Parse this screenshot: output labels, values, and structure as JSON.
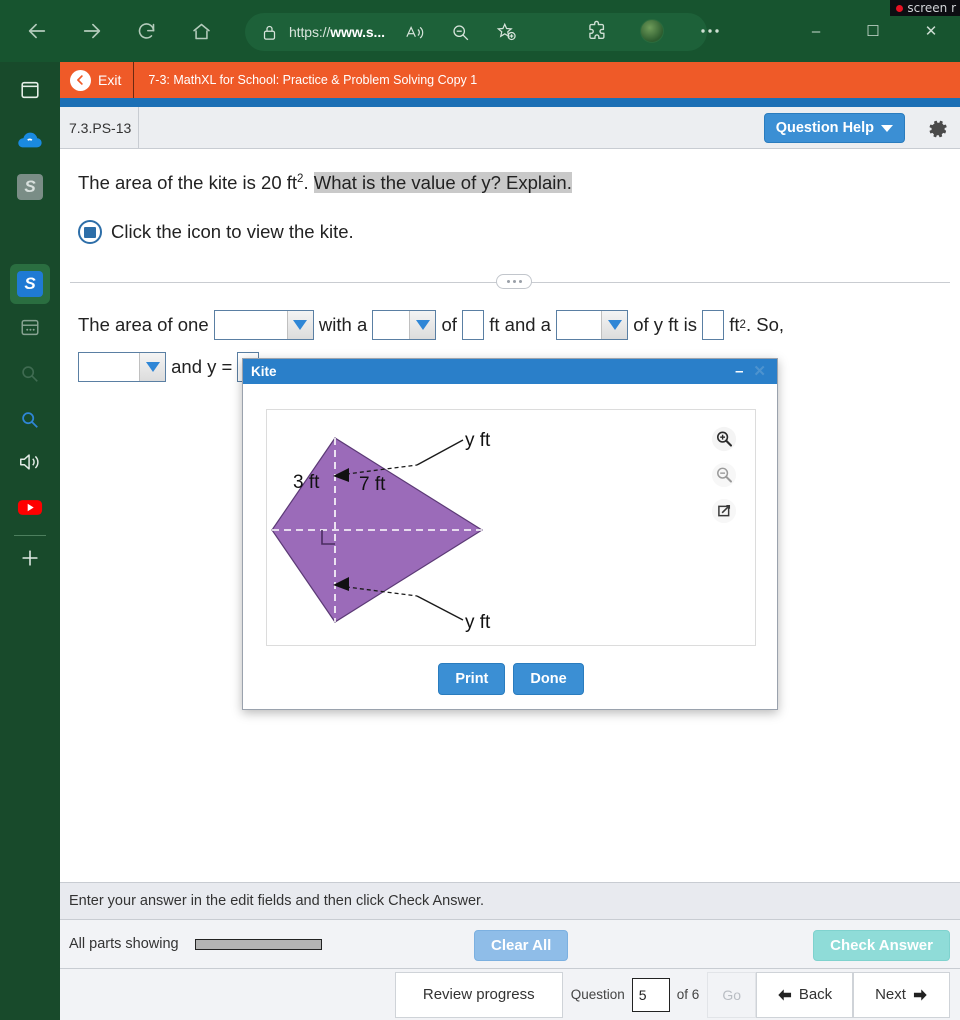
{
  "browser": {
    "nav": {
      "back": "back-arrow",
      "forward": "forward-arrow",
      "reload": "reload",
      "home": "home"
    },
    "url_prefix": "https://",
    "url_bold": "www.s...",
    "lock_icon": "lock-icon",
    "read_aloud_icon": "read-aloud-icon",
    "zoom_icon": "zoom-out-icon",
    "favorite_icon": "add-favorite-icon",
    "extensions_icon": "extensions-icon",
    "profile_icon": "profile-avatar",
    "more_icon": "more-settings-icon",
    "minimize": "–",
    "maximize": "☐",
    "close": "✕",
    "recording_label": "screen r"
  },
  "rail": {
    "items": [
      {
        "name": "tab-actions",
        "label": "Tab actions"
      },
      {
        "name": "edge-copilot",
        "label": "Copilot"
      },
      {
        "name": "app-s-inactive",
        "label": "S"
      },
      {
        "name": "app-s-active",
        "label": "S"
      },
      {
        "name": "collections",
        "label": "Collections"
      },
      {
        "name": "search-dim",
        "label": "Search"
      },
      {
        "name": "search-blue",
        "label": "Search"
      },
      {
        "name": "sound",
        "label": "Sound"
      },
      {
        "name": "youtube",
        "label": "YouTube"
      },
      {
        "name": "add",
        "label": "+"
      }
    ]
  },
  "mathxl": {
    "exit_label": "Exit",
    "assignment_title": "7-3: MathXL for School: Practice & Problem Solving Copy 1",
    "question_id": "7.3.PS-13",
    "question_help_label": "Question Help",
    "settings_icon": "gear-icon"
  },
  "question": {
    "stem_a": "The area of the kite is 20 ft",
    "stem_sup": "2",
    "stem_b": ". ",
    "stem_highlight": "What is the value of y? Explain.",
    "icon_line": "Click the icon to view the kite.",
    "fill_row1": {
      "t1": "The area of one ",
      "t2": " with a ",
      "t3": " of ",
      "t4": " ft and a ",
      "t5": " of y ft is ",
      "t6": " ft",
      "sup": "2",
      "t7": ". So,"
    },
    "fill_row2": {
      "t1": " and y = "
    }
  },
  "modal": {
    "title": "Kite",
    "minimize_label": "–",
    "close_label": "✕",
    "zoom_in_icon": "zoom-in-icon",
    "zoom_out_icon": "zoom-out-icon",
    "popout_icon": "pop-out-icon",
    "print_label": "Print",
    "done_label": "Done",
    "figure": {
      "fill_color": "#9b6bb9",
      "stroke_color": "#5c3a76",
      "labels": {
        "left_segment": "3 ft",
        "right_segment": "7 ft",
        "top_diagonal": "y ft",
        "bottom_diagonal": "y ft"
      }
    }
  },
  "footer": {
    "hint": "Enter your answer in the edit fields and then click Check Answer.",
    "all_parts": "All parts showing",
    "clear_all": "Clear All",
    "check_answer": "Check Answer",
    "review_progress": "Review progress",
    "question_word": "Question",
    "question_number": "5",
    "of_total": "of 6",
    "go_label": "Go",
    "back_label": "Back",
    "next_label": "Next"
  },
  "colors": {
    "chrome_green": "#17542f",
    "mathxl_orange": "#ef5a28",
    "accent_blue": "#3b8fd4",
    "modal_title_blue": "#2a7fc9",
    "kite_purple": "#9b6bb9"
  }
}
